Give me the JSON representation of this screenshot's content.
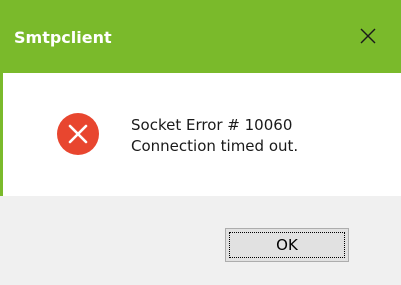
{
  "window": {
    "title": "Smtpclient",
    "close_icon": "close-icon",
    "accent_color": "#7aba2b"
  },
  "message": {
    "icon": "error-icon",
    "line1": "Socket Error # 10060",
    "line2": "Connection timed out."
  },
  "buttons": {
    "ok_label": "OK"
  }
}
